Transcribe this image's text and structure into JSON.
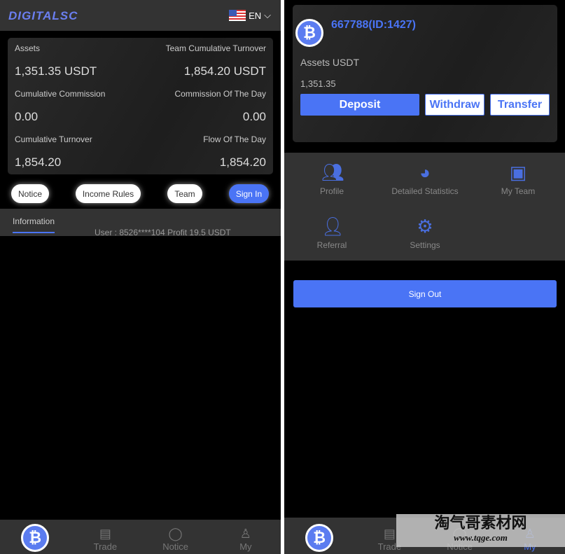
{
  "left": {
    "brand": "DIGITALSC",
    "language": "EN",
    "stats": [
      {
        "label": "Assets",
        "value": "1,351.35 USDT"
      },
      {
        "label": "Team Cumulative Turnover",
        "value": "1,854.20 USDT"
      },
      {
        "label": "Cumulative Commission",
        "value": "0.00"
      },
      {
        "label": "Commission Of The Day",
        "value": "0.00"
      },
      {
        "label": "Cumulative Turnover",
        "value": "1,854.20"
      },
      {
        "label": "Flow Of The Day",
        "value": "1,854.20"
      }
    ],
    "buttons": [
      "Notice",
      "Income Rules",
      "Team",
      "Sign In"
    ],
    "info_tab": "Information",
    "ticker": "User : 8526****104 Profit 19.5 USDT",
    "nav": [
      "Trade",
      "Notice",
      "My"
    ]
  },
  "right": {
    "user": "667788(ID:1427)",
    "assets_label": "Assets USDT",
    "assets_value": "1,351.35",
    "deposit": "Deposit",
    "withdraw": "Withdraw",
    "transfer": "Transfer",
    "menu": [
      "Profile",
      "Detailed Statistics",
      "My Team",
      "Referral",
      "Settings"
    ],
    "sign_out": "Sign Out",
    "nav": [
      "Trade",
      "Notice",
      "My"
    ]
  },
  "watermark": {
    "title": "淘气哥素材网",
    "url": "www.tqge.com"
  },
  "colors": {
    "accent": "#4a74f5",
    "panel": "#333333",
    "background": "#000000"
  }
}
